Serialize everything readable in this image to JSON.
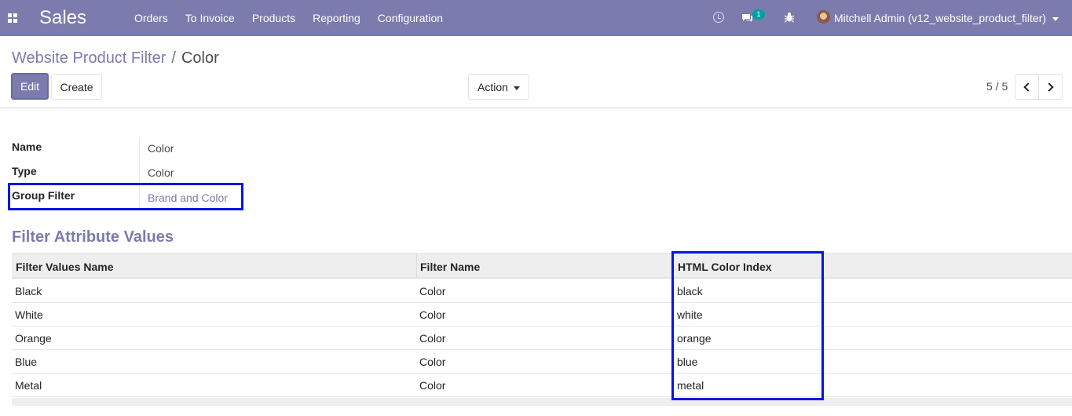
{
  "navbar": {
    "app_name": "Sales",
    "menu": [
      "Orders",
      "To Invoice",
      "Products",
      "Reporting",
      "Configuration"
    ],
    "chat_count": "1",
    "user": "Mitchell Admin (v12_website_product_filter)",
    "icons": [
      "apps-icon",
      "clock-icon",
      "chat-icon",
      "bug-icon",
      "avatar"
    ]
  },
  "breadcrumb": {
    "parent": "Website Product Filter",
    "separator": "/",
    "current": "Color"
  },
  "toolbar": {
    "edit_label": "Edit",
    "create_label": "Create",
    "action_label": "Action"
  },
  "pager": {
    "value": "5 / 5"
  },
  "form": {
    "name_label": "Name",
    "name_value": "Color",
    "type_label": "Type",
    "type_value": "Color",
    "group_label": "Group Filter",
    "group_value": "Brand and Color"
  },
  "section_title": "Filter Attribute Values",
  "table": {
    "headers": [
      "Filter Values Name",
      "Filter Name",
      "HTML Color Index"
    ],
    "rows": [
      [
        "Black",
        "Color",
        "black"
      ],
      [
        "White",
        "Color",
        "white"
      ],
      [
        "Orange",
        "Color",
        "orange"
      ],
      [
        "Blue",
        "Color",
        "blue"
      ],
      [
        "Metal",
        "Color",
        "metal"
      ]
    ]
  },
  "colors": {
    "navbar": "#7c7bad",
    "accent": "#7c7bad",
    "highlight_box": "#0016e0",
    "badge": "#00a09d"
  }
}
